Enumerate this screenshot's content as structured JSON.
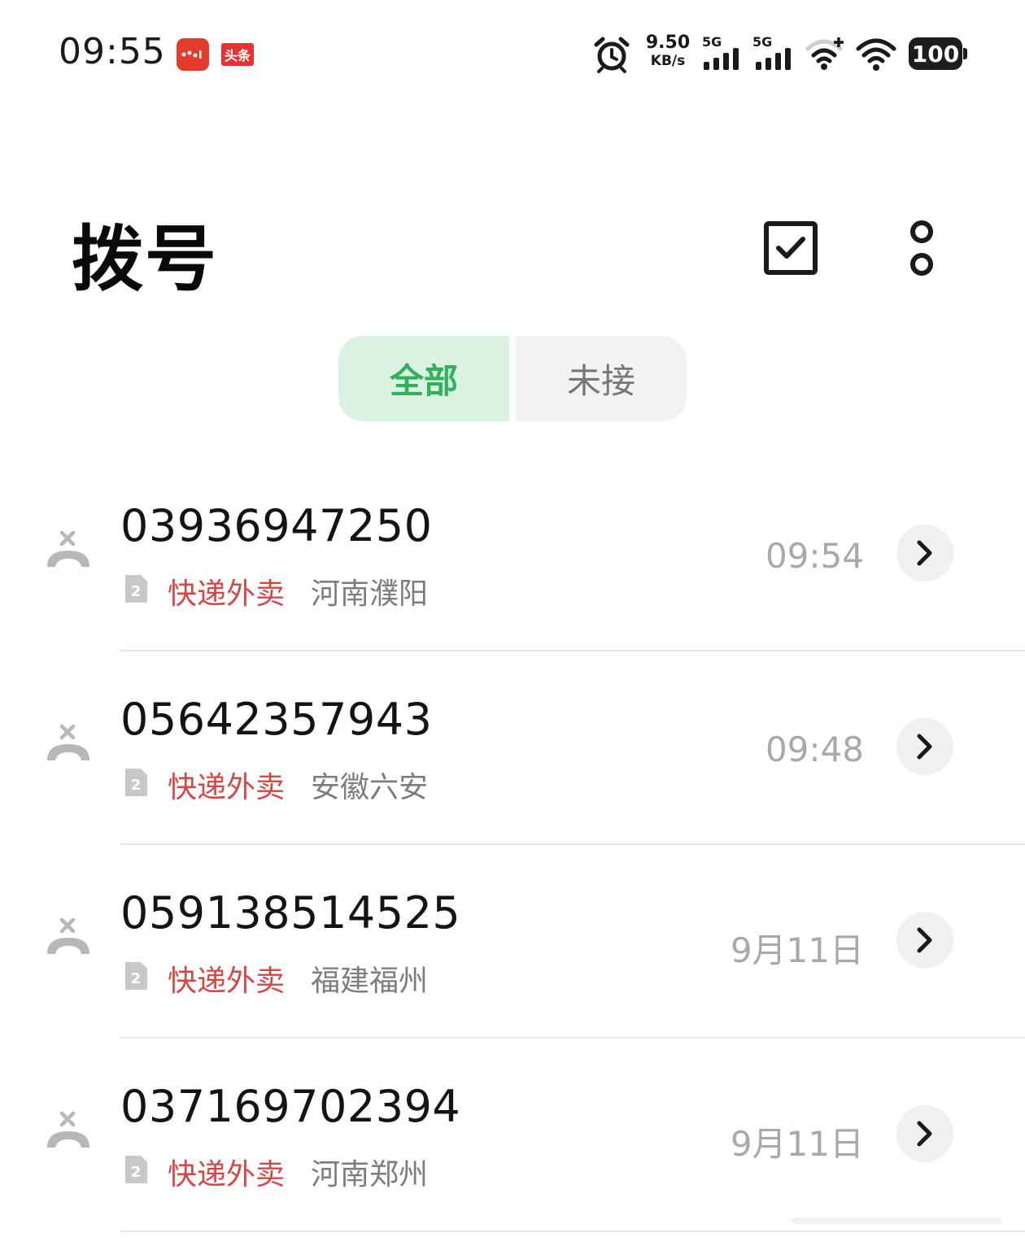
{
  "status_bar": {
    "time": "09:55",
    "app_icons": [
      "app-notification-icon",
      "toutiao-icon"
    ],
    "toutiao_label": "头条",
    "net_speed_value": "9.50",
    "net_speed_unit": "KB/s",
    "signal1_label": "5G",
    "signal2_label": "5G",
    "battery": "100"
  },
  "header": {
    "title": "拨号",
    "select_icon": "checkbox-select-icon",
    "more_icon": "more-dots-icon"
  },
  "tabs": [
    {
      "label": "全部",
      "selected": true
    },
    {
      "label": "未接",
      "selected": false
    }
  ],
  "calls": [
    {
      "number": "03936947250",
      "sim": "2",
      "tag": "快递外卖",
      "location": "河南濮阳",
      "time": "09:54"
    },
    {
      "number": "05642357943",
      "sim": "2",
      "tag": "快递外卖",
      "location": "安徽六安",
      "time": "09:48"
    },
    {
      "number": "059138514525",
      "sim": "2",
      "tag": "快递外卖",
      "location": "福建福州",
      "time": "9月11日"
    },
    {
      "number": "037169702394",
      "sim": "2",
      "tag": "快递外卖",
      "location": "河南郑州",
      "time": "9月11日"
    }
  ],
  "colors": {
    "accent_green": "#31b25a",
    "tab_selected_bg": "#dcf3e4",
    "tag_red": "#d64646",
    "muted_gray": "#a9a9a9"
  }
}
